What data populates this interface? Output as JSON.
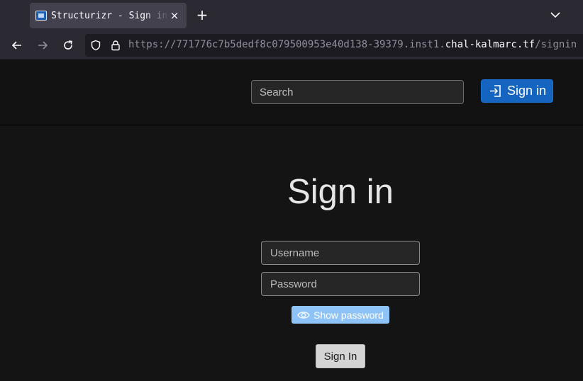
{
  "browser": {
    "tab": {
      "title": "Structurizr - Sign in",
      "close_label": "×"
    },
    "new_tab_label": "+",
    "url": {
      "prefix": "https://771776c7b5dedf8c079500953e40d138-39379.inst1.",
      "host": "chal-kalmarc.tf",
      "path": "/signin"
    },
    "icons": [
      "back-icon",
      "forward-icon",
      "reload-icon",
      "shield-icon",
      "lock-icon",
      "chevron-down-icon"
    ]
  },
  "header": {
    "search_placeholder": "Search",
    "signin_label": "Sign in",
    "accent": "#1565c0"
  },
  "main": {
    "title": "Sign in",
    "username_placeholder": "Username",
    "password_placeholder": "Password",
    "show_password_label": "Show password",
    "submit_label": "Sign In"
  }
}
